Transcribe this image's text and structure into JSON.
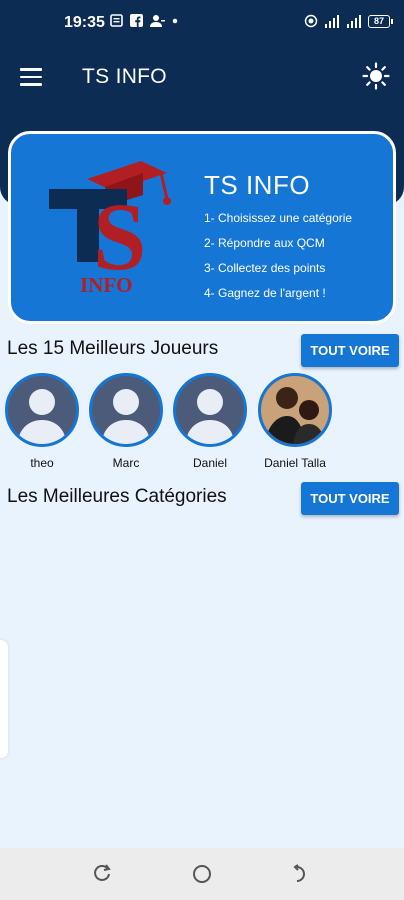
{
  "status_bar": {
    "time": "19:35",
    "left_icons": [
      "gallery-icon",
      "facebook-icon",
      "contacts-icon",
      "dot-icon"
    ],
    "right_icons": [
      "hotspot-icon",
      "signal-icon",
      "signal-icon-2"
    ],
    "battery": "87"
  },
  "app_bar": {
    "title": "TS INFO",
    "menu_icon": "hamburger-menu-icon",
    "theme_icon": "sun-icon"
  },
  "banner": {
    "logo_text": "INFO",
    "title": "TS INFO",
    "steps": [
      "1- Choisissez une catégorie",
      "2- Répondre aux QCM",
      "3- Collectez des points",
      "4- Gagnez de l'argent !"
    ]
  },
  "top_players": {
    "title": "Les 15 Meilleurs Joueurs",
    "see_all": "TOUT VOIRE",
    "players": [
      {
        "name": "theo",
        "avatar": "default-avatar"
      },
      {
        "name": "Marc",
        "avatar": "default-avatar"
      },
      {
        "name": "Daniel",
        "avatar": "default-avatar"
      },
      {
        "name": "Daniel Talla",
        "avatar": "photo"
      }
    ]
  },
  "categories": {
    "title": "Les Meilleures Catégories",
    "see_all": "TOUT VOIRE"
  },
  "colors": {
    "header": "#0d2c54",
    "accent": "#1676d6",
    "background": "#e9f3fd",
    "logo_red": "#b11f24"
  },
  "nav_bar": {
    "icons": [
      "recent-apps-icon",
      "home-icon",
      "back-icon"
    ]
  }
}
